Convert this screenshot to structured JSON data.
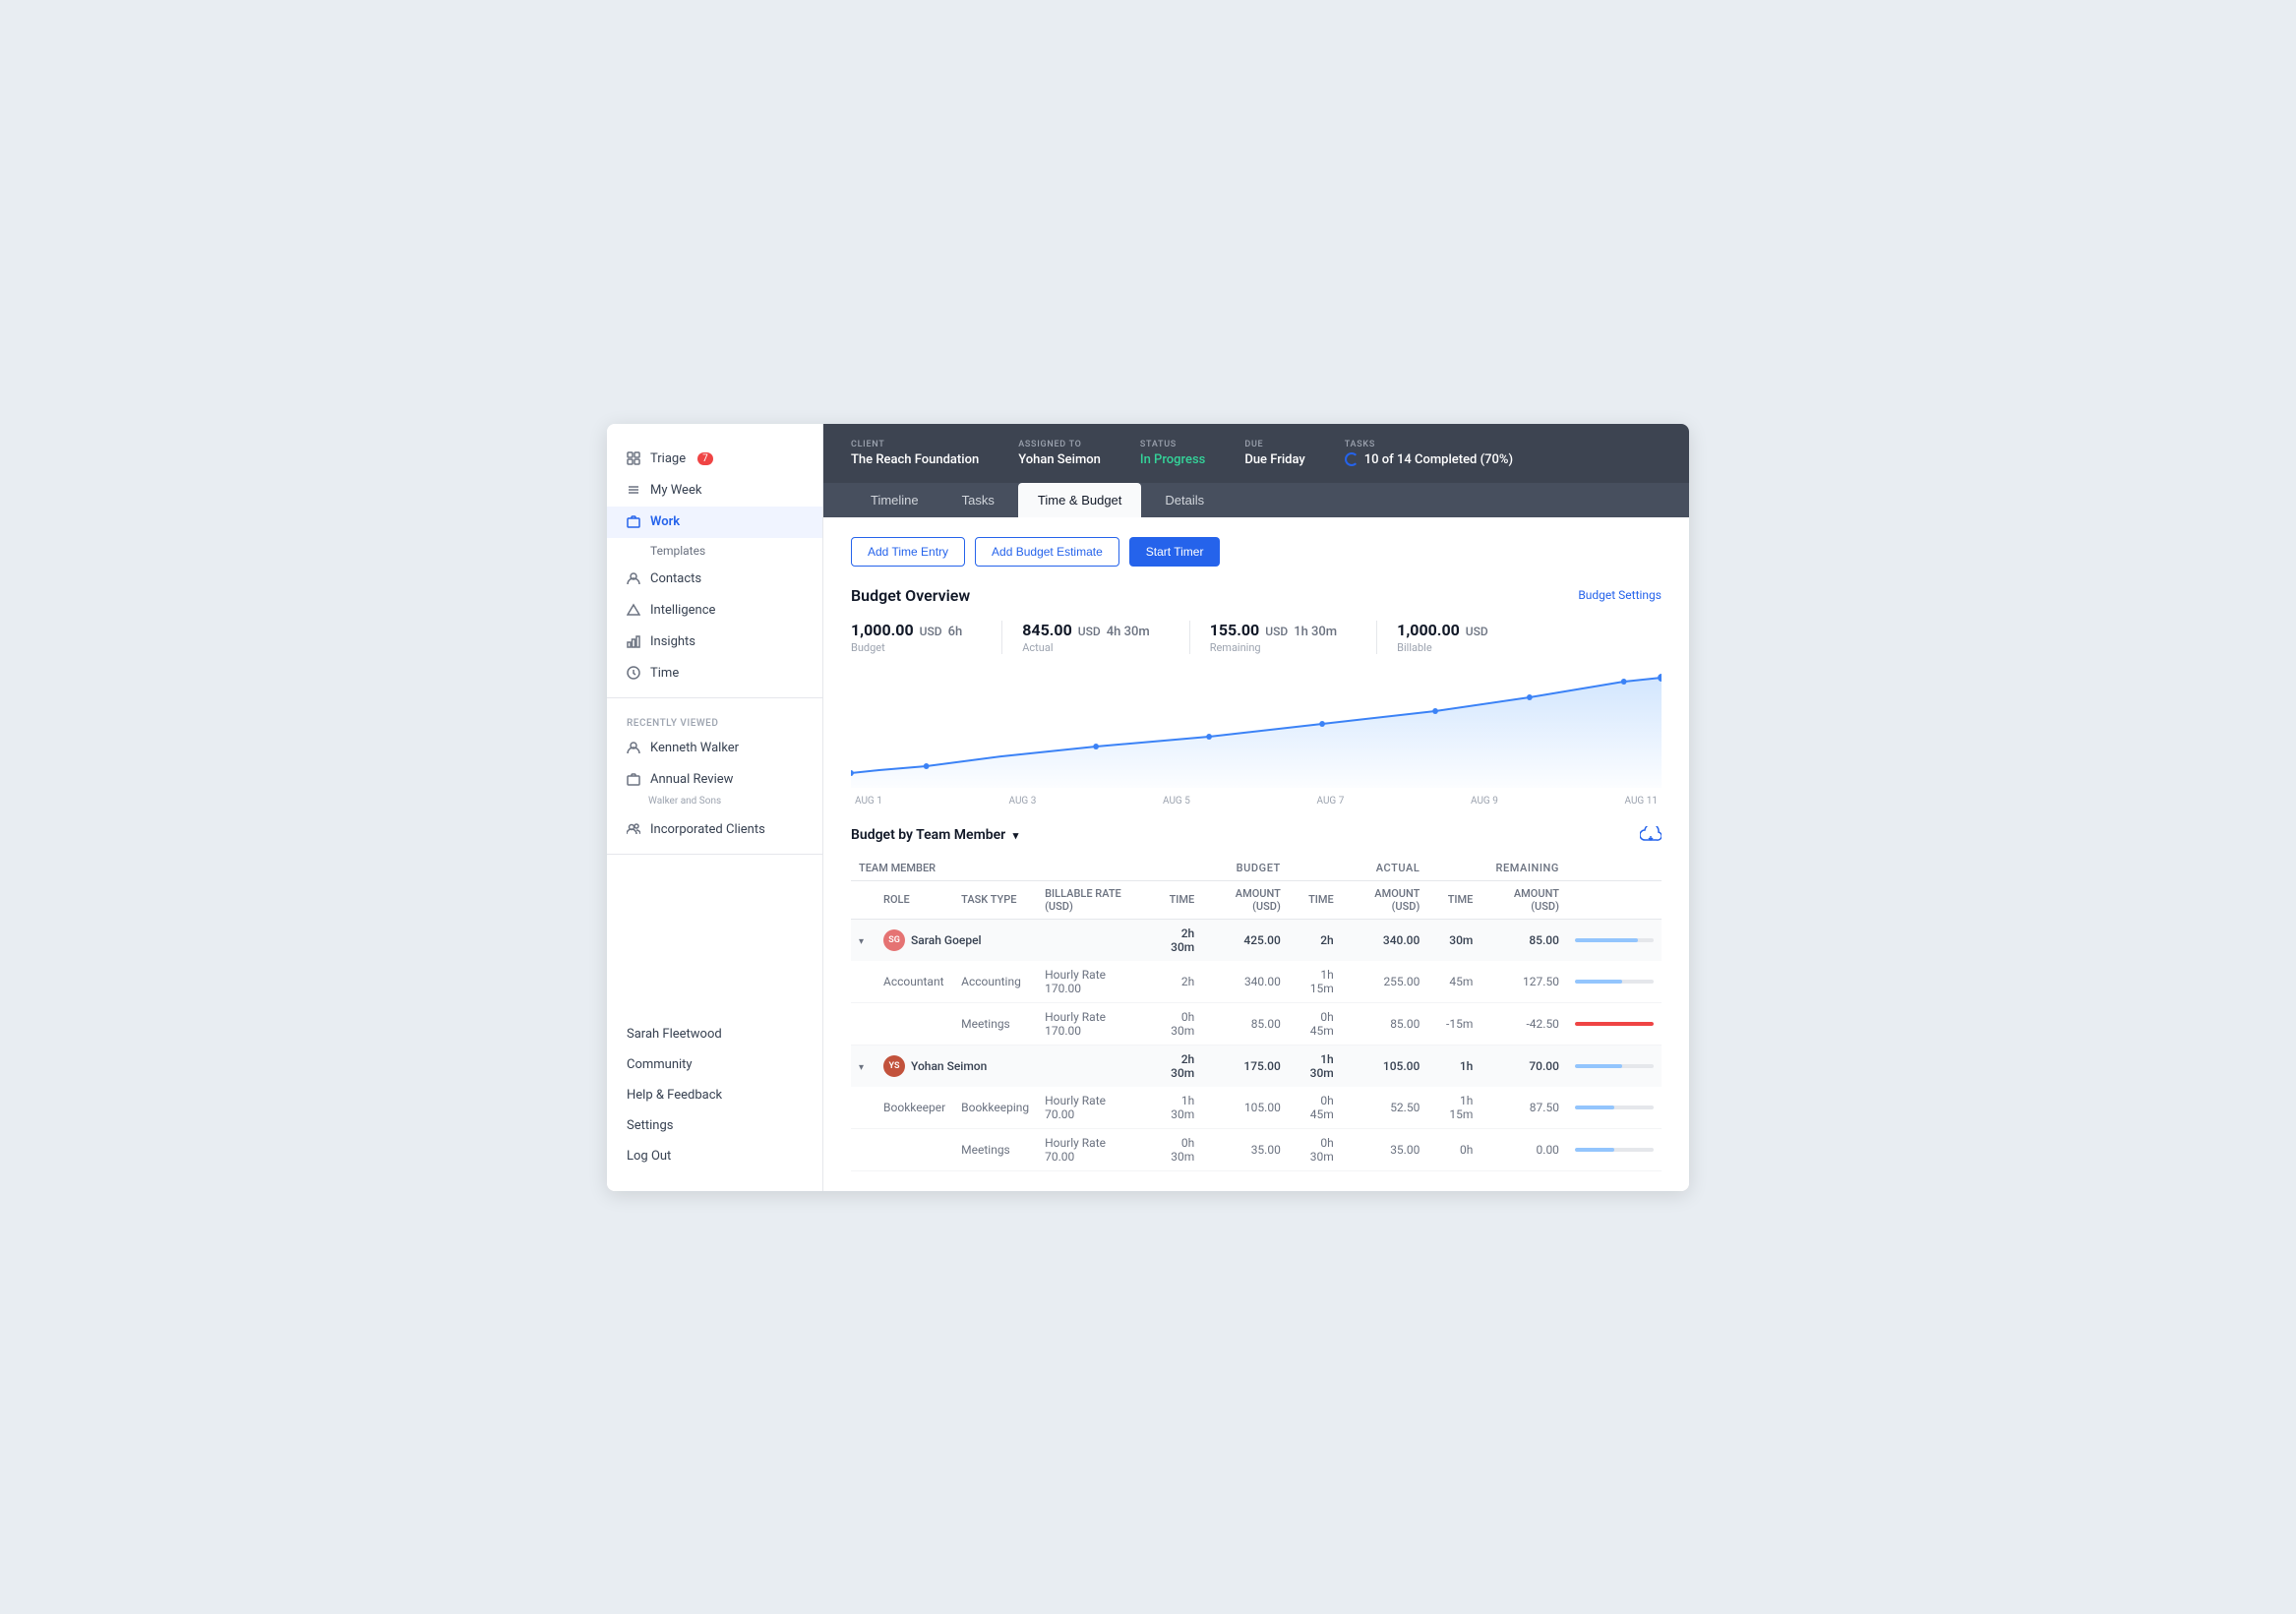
{
  "sidebar": {
    "items": [
      {
        "id": "triage",
        "label": "Triage",
        "badge": "7",
        "icon": "grid"
      },
      {
        "id": "my-week",
        "label": "My Week",
        "icon": "list"
      },
      {
        "id": "work",
        "label": "Work",
        "icon": "briefcase",
        "active": true
      },
      {
        "id": "templates",
        "label": "Templates",
        "sub": true
      },
      {
        "id": "contacts",
        "label": "Contacts",
        "icon": "person"
      },
      {
        "id": "intelligence",
        "label": "Intelligence",
        "icon": "triangle"
      },
      {
        "id": "insights",
        "label": "Insights",
        "icon": "bar-chart"
      },
      {
        "id": "time",
        "label": "Time",
        "icon": "clock"
      }
    ],
    "recently_viewed_label": "Recently Viewed",
    "recent_items": [
      {
        "label": "Kenneth Walker",
        "icon": "person"
      },
      {
        "label": "Annual Review",
        "sub": "Walker and Sons",
        "icon": "briefcase"
      },
      {
        "label": "Incorporated Clients",
        "icon": "people"
      }
    ],
    "bottom_items": [
      {
        "label": "Sarah Fleetwood"
      },
      {
        "label": "Community"
      },
      {
        "label": "Help & Feedback"
      },
      {
        "label": "Settings"
      },
      {
        "label": "Log Out"
      }
    ]
  },
  "header": {
    "client_label": "CLIENT",
    "client_value": "The Reach Foundation",
    "assigned_label": "ASSIGNED TO",
    "assigned_value": "Yohan Seimon",
    "status_label": "STATUS",
    "status_value": "In Progress",
    "due_label": "DUE",
    "due_value": "Due Friday",
    "tasks_label": "TASKS",
    "tasks_value": "10 of 14 Completed (70%)"
  },
  "tabs": [
    {
      "label": "Timeline",
      "active": false
    },
    {
      "label": "Tasks",
      "active": false
    },
    {
      "label": "Time & Budget",
      "active": true
    },
    {
      "label": "Details",
      "active": false
    }
  ],
  "actions": {
    "add_time_entry": "Add Time Entry",
    "add_budget_estimate": "Add Budget Estimate",
    "start_timer": "Start Timer"
  },
  "budget_overview": {
    "title": "Budget Overview",
    "settings_link": "Budget Settings",
    "budget_amount": "1,000.00",
    "budget_currency": "USD",
    "budget_time": "6h",
    "budget_label": "Budget",
    "actual_amount": "845.00",
    "actual_currency": "USD",
    "actual_time": "4h 30m",
    "actual_label": "Actual",
    "remaining_amount": "155.00",
    "remaining_currency": "USD",
    "remaining_time": "1h 30m",
    "remaining_label": "Remaining",
    "billable_amount": "1,000.00",
    "billable_currency": "USD",
    "billable_label": "Billable",
    "chart_labels": [
      "AUG 1",
      "AUG 3",
      "AUG 5",
      "AUG 7",
      "AUG 9",
      "AUG 11"
    ]
  },
  "budget_team": {
    "title": "Budget by Team Member",
    "columns": {
      "team_member": "TEAM MEMBER",
      "role": "ROLE",
      "task_type": "TASK TYPE",
      "billable_rate": "BILLABLE RATE (USD)",
      "budget_group": "BUDGET",
      "actual_group": "ACTUAL",
      "remaining_group": "REMAINING",
      "budget_time": "TIME",
      "budget_amount": "AMOUNT (USD)",
      "actual_time": "TIME",
      "actual_amount": "AMOUNT (USD)",
      "remaining_time": "TIME",
      "remaining_amount": "AMOUNT (USD)"
    },
    "members": [
      {
        "name": "Sarah Goepel",
        "avatar_color": "#e57373",
        "initials": "SG",
        "budget_time": "2h 30m",
        "budget_amount": "425.00",
        "actual_time": "2h",
        "actual_amount": "340.00",
        "remaining_time": "30m",
        "remaining_amount": "85.00",
        "progress": 80,
        "progress_type": "blue",
        "details": [
          {
            "role": "Accountant",
            "task_type": "Accounting",
            "billable_rate_type": "Hourly Rate",
            "billable_rate": "170.00",
            "budget_time": "2h",
            "budget_amount": "340.00",
            "actual_time": "1h 15m",
            "actual_amount": "255.00",
            "remaining_time": "45m",
            "remaining_amount": "127.50",
            "progress": 60,
            "progress_type": "blue"
          },
          {
            "role": "",
            "task_type": "Meetings",
            "billable_rate_type": "Hourly Rate",
            "billable_rate": "170.00",
            "budget_time": "0h 30m",
            "budget_amount": "85.00",
            "actual_time": "0h 45m",
            "actual_amount": "85.00",
            "remaining_time": "-15m",
            "remaining_amount": "-42.50",
            "progress": 100,
            "progress_type": "red"
          }
        ]
      },
      {
        "name": "Yohan Seimon",
        "avatar_color": "#c2523c",
        "initials": "YS",
        "budget_time": "2h 30m",
        "budget_amount": "175.00",
        "actual_time": "1h 30m",
        "actual_amount": "105.00",
        "remaining_time": "1h",
        "remaining_amount": "70.00",
        "progress": 60,
        "progress_type": "blue",
        "details": [
          {
            "role": "Bookkeeper",
            "task_type": "Bookkeeping",
            "billable_rate_type": "Hourly Rate",
            "billable_rate": "70.00",
            "budget_time": "1h 30m",
            "budget_amount": "105.00",
            "actual_time": "0h 45m",
            "actual_amount": "52.50",
            "remaining_time": "1h 15m",
            "remaining_amount": "87.50",
            "progress": 50,
            "progress_type": "blue"
          },
          {
            "role": "",
            "task_type": "Meetings",
            "billable_rate_type": "Hourly Rate",
            "billable_rate": "70.00",
            "budget_time": "0h 30m",
            "budget_amount": "35.00",
            "actual_time": "0h 30m",
            "actual_amount": "35.00",
            "remaining_time": "0h",
            "remaining_amount": "0.00",
            "progress": 50,
            "progress_type": "blue"
          }
        ]
      }
    ]
  }
}
